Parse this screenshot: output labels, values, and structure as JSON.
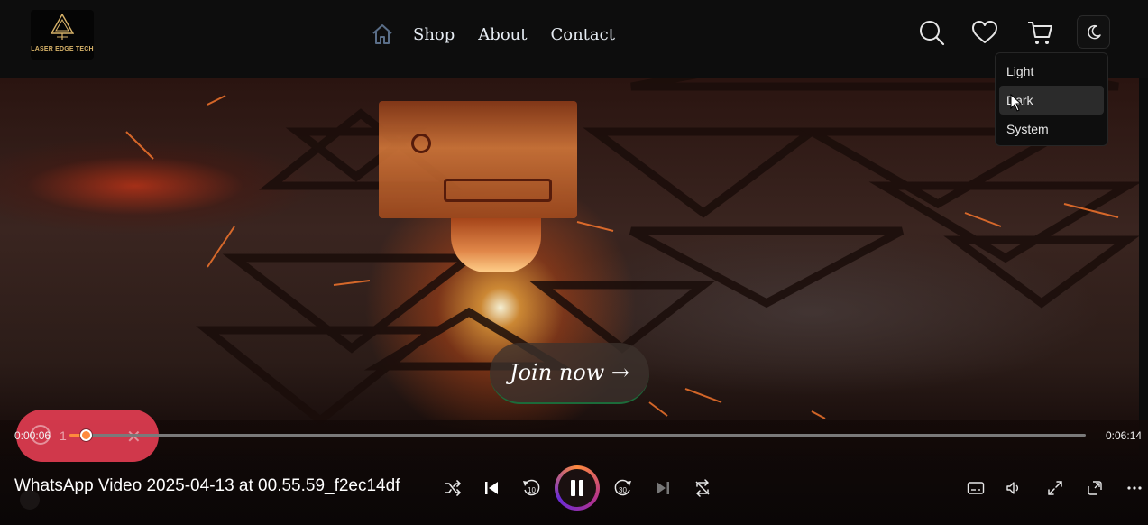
{
  "navbar": {
    "logo_text": "LASER EDGE TECH",
    "links": [
      {
        "label": "Shop"
      },
      {
        "label": "About"
      },
      {
        "label": "Contact"
      }
    ],
    "icons": [
      "home-icon",
      "search-icon",
      "heart-icon",
      "cart-icon",
      "moon-icon"
    ]
  },
  "theme_menu": {
    "items": [
      {
        "label": "Light"
      },
      {
        "label": "Dark"
      },
      {
        "label": "System"
      }
    ],
    "selected": "Dark"
  },
  "hero": {
    "cta_label": "Join now →"
  },
  "player": {
    "title": "WhatsApp Video 2025-04-13 at 00.55.59_f2ec14df",
    "current_time": "0:00:06",
    "duration": "0:06:14",
    "progress_fraction": 0.016,
    "toast_number": "1",
    "accent_color": "#ff8a3d",
    "controls": [
      "shuffle-icon",
      "previous-icon",
      "rewind-10-icon",
      "pause-icon",
      "forward-30-icon",
      "next-icon",
      "repeat-off-icon",
      "captions-icon",
      "volume-icon",
      "fullscreen-icon",
      "mini-player-icon",
      "more-icon"
    ]
  },
  "colors": {
    "toast": "#f04056",
    "nav_text": "#e6ecf3",
    "logo_gold": "#d8b36a"
  }
}
